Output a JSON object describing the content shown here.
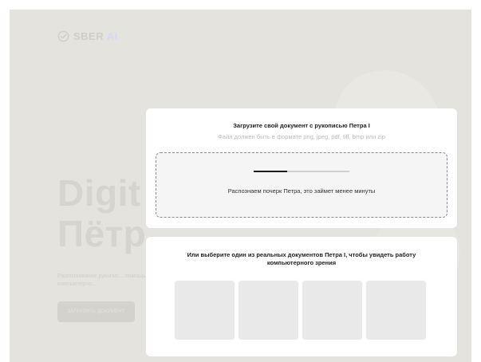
{
  "brand": {
    "logo": "SBER",
    "logo_suffix": "AI",
    "logo_icon": "check-circle-icon"
  },
  "hero": {
    "line1": "Digit",
    "line2": "Пётр",
    "subtitle": "Распознавание рукопис... помощью компьютерно...",
    "button_label": "Загрузить документ"
  },
  "upload": {
    "title": "Загрузите свой документ с рукописью Петра I",
    "formats_hint": "Файл должен быть в формате png, jpeg, pdf, tiff, bmp или zip",
    "progress_fraction": 0.35,
    "status": "Распознаем почерк Петра, это займет менее минуты"
  },
  "examples": {
    "title": "Или выберите один из реальных документов Петра I, чтобы увидеть работу компьютерного зрения",
    "count": 4
  },
  "colors": {
    "background_overlay": "#e4e3dd",
    "card": "#ffffff",
    "progress_fill": "#1c1c1c",
    "progress_track": "#cfcfcf",
    "logo_ai": "#d9d8f2"
  }
}
